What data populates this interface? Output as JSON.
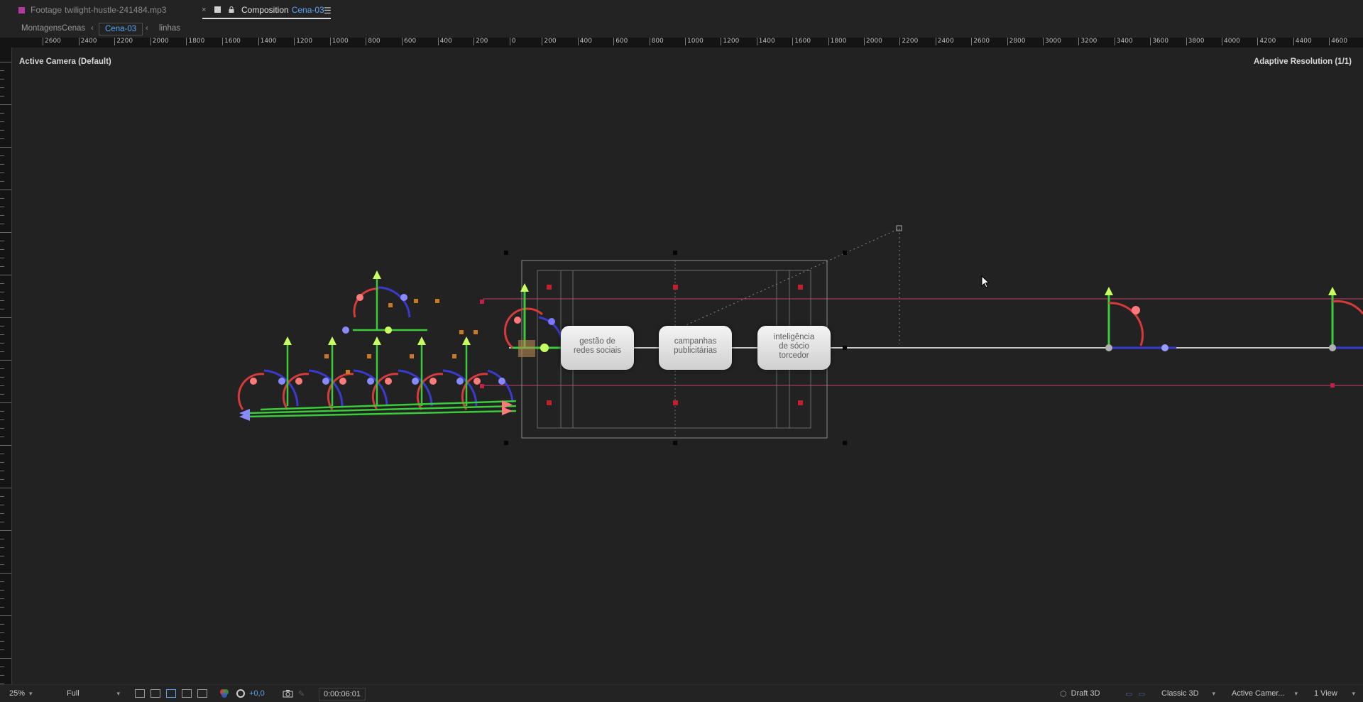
{
  "tabs": [
    {
      "type_label": "Footage",
      "name": "twilight-hustle-241484.mp3",
      "swatch": "#b23a9e"
    },
    {
      "type_label": "Composition",
      "name": "Cena-03",
      "menu_icon": "hamburger-icon"
    }
  ],
  "breadcrumbs": {
    "items": [
      "MontagensCenas",
      "Cena-03",
      "linhas"
    ]
  },
  "ruler": {
    "horizontal": [
      "2600",
      "2400",
      "2200",
      "2000",
      "1800",
      "1600",
      "1400",
      "1200",
      "1000",
      "800",
      "600",
      "400",
      "200",
      "0",
      "200",
      "400",
      "600",
      "800",
      "1000",
      "1200",
      "1400",
      "1600",
      "1800",
      "2000",
      "2200",
      "2400",
      "2600",
      "2800",
      "3000",
      "3200",
      "3400",
      "3600",
      "3800",
      "4000",
      "4200",
      "4400",
      "4600"
    ]
  },
  "viewer": {
    "camera_label": "Active Camera (Default)",
    "resolution_label": "Adaptive Resolution (1/1)",
    "layers": [
      {
        "lines": [
          "gestão de",
          "redes sociais"
        ]
      },
      {
        "lines": [
          "campanhas",
          "publicitárias"
        ]
      },
      {
        "lines": [
          "inteligência",
          "de sócio",
          "torcedor"
        ]
      }
    ]
  },
  "bottom": {
    "zoom": "25%",
    "resolution": "Full",
    "exposure": "+0,0",
    "timecode": "0:00:06:01",
    "renderer_mode": "Draft 3D",
    "renderer": "Classic 3D",
    "camera": "Active Camer...",
    "views": "1 View"
  }
}
